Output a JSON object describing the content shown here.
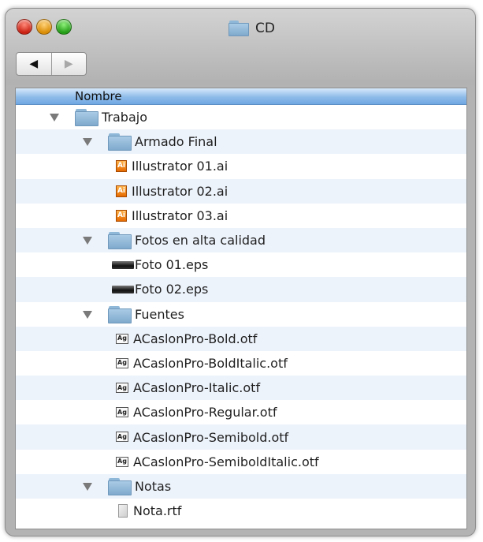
{
  "window": {
    "title": "CD",
    "nav": {
      "back": "◀",
      "forward": "▶"
    }
  },
  "list": {
    "column_header": "Nombre",
    "items": [
      {
        "label": "Trabajo",
        "type": "folder",
        "level": 0,
        "expanded": true
      },
      {
        "label": "Armado Final",
        "type": "folder",
        "level": 1,
        "expanded": true
      },
      {
        "label": "Illustrator 01.ai",
        "type": "ai",
        "level": 2
      },
      {
        "label": "Illustrator 02.ai",
        "type": "ai",
        "level": 2
      },
      {
        "label": "Illustrator 03.ai",
        "type": "ai",
        "level": 2
      },
      {
        "label": "Fotos en alta calidad",
        "type": "folder",
        "level": 1,
        "expanded": true
      },
      {
        "label": "Foto 01.eps",
        "type": "eps",
        "level": 2
      },
      {
        "label": "Foto 02.eps",
        "type": "eps",
        "level": 2
      },
      {
        "label": "Fuentes",
        "type": "folder",
        "level": 1,
        "expanded": true
      },
      {
        "label": "ACaslonPro-Bold.otf",
        "type": "font",
        "level": 2
      },
      {
        "label": "ACaslonPro-BoldItalic.otf",
        "type": "font",
        "level": 2
      },
      {
        "label": "ACaslonPro-Italic.otf",
        "type": "font",
        "level": 2
      },
      {
        "label": "ACaslonPro-Regular.otf",
        "type": "font",
        "level": 2
      },
      {
        "label": "ACaslonPro-Semibold.otf",
        "type": "font",
        "level": 2
      },
      {
        "label": "ACaslonPro-SemiboldItalic.otf",
        "type": "font",
        "level": 2
      },
      {
        "label": "Notas",
        "type": "folder",
        "level": 1,
        "expanded": true
      },
      {
        "label": "Nota.rtf",
        "type": "doc",
        "level": 2
      }
    ]
  },
  "icons": {
    "ai_glyph": "Ai",
    "font_glyph": "Ag"
  },
  "colors": {
    "header_blue": "#8ebbe9",
    "row_alt": "#edf3fb",
    "folder_blue": "#a9cbe6"
  }
}
